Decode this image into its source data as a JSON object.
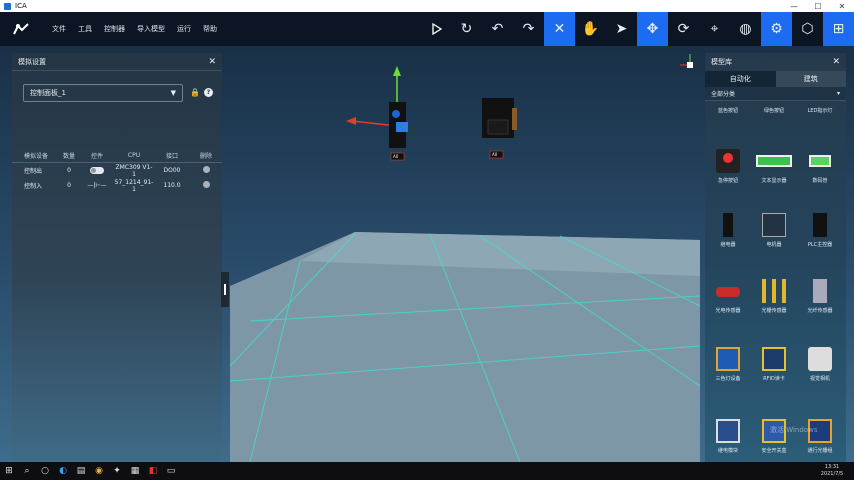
{
  "window": {
    "title": "ICA",
    "min": "—",
    "max": "☐",
    "close": "✕"
  },
  "menu": [
    "文件",
    "工具",
    "控制器",
    "导入模型",
    "运行",
    "帮助"
  ],
  "toolbar_icons": [
    "play-icon",
    "reset-icon",
    "undo-icon",
    "redo-icon",
    "transform-icon",
    "hand-icon",
    "pointer-icon",
    "move-icon",
    "rotate-icon",
    "target-icon",
    "globe-icon",
    "settings-icon",
    "box-icon",
    "grid-icon"
  ],
  "left_panel": {
    "title": "模拟设置",
    "selected_device": "控制面板_1",
    "table": {
      "headers": [
        "模拟设备",
        "数量",
        "控件",
        "CPU",
        "接口",
        "删除"
      ],
      "rows": [
        {
          "device": "控制出",
          "count": "0",
          "cpu": "ZMC309 V1-1",
          "port": "DO00"
        },
        {
          "device": "控制入",
          "count": "0",
          "cpu": "57_1214_91-1",
          "port": "110.0"
        }
      ]
    }
  },
  "right_panel": {
    "title": "模型库",
    "tabs": [
      "自动化",
      "建筑"
    ],
    "category": "全部分类",
    "items": [
      "蓝色按钮",
      "绿色按钮",
      "LED指示灯",
      "急停按钮",
      "文本显示器",
      "数码管",
      "继电器",
      "电机器",
      "PLC主控器",
      "光电传感器",
      "光栅传感器",
      "光纤传感器",
      "三色灯设备",
      "RFID读卡",
      "视觉相机",
      "继电模块",
      "安全开关盒",
      "通行光栅组"
    ]
  },
  "viewport": {
    "tag_a": "A0",
    "tag_b": "A0"
  },
  "taskbar": {
    "time": "13:31",
    "date": "2021/7/5"
  },
  "watermark": "激活 Windows"
}
